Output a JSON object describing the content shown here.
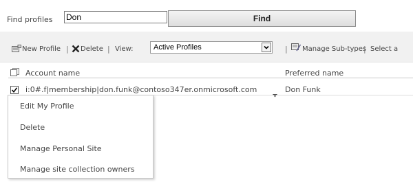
{
  "search": {
    "label": "Find profiles",
    "value": "Don",
    "button_label": "Find"
  },
  "toolbar": {
    "new_profile": "New Profile",
    "delete": "Delete",
    "view_label": "View:",
    "view_selected": "Active Profiles",
    "manage_subtypes": "Manage Sub-types",
    "select_partial": "Select a",
    "separator": "|"
  },
  "table": {
    "columns": [
      "Account name",
      "Preferred name"
    ],
    "rows": [
      {
        "account": "i:0#.f|membership|don.funk@contoso347er.onmicrosoft.com",
        "preferred": "Don Funk"
      }
    ]
  },
  "context_menu": {
    "items": [
      "Edit My Profile",
      "Delete",
      "Manage Personal Site",
      "Manage site collection owners"
    ]
  }
}
